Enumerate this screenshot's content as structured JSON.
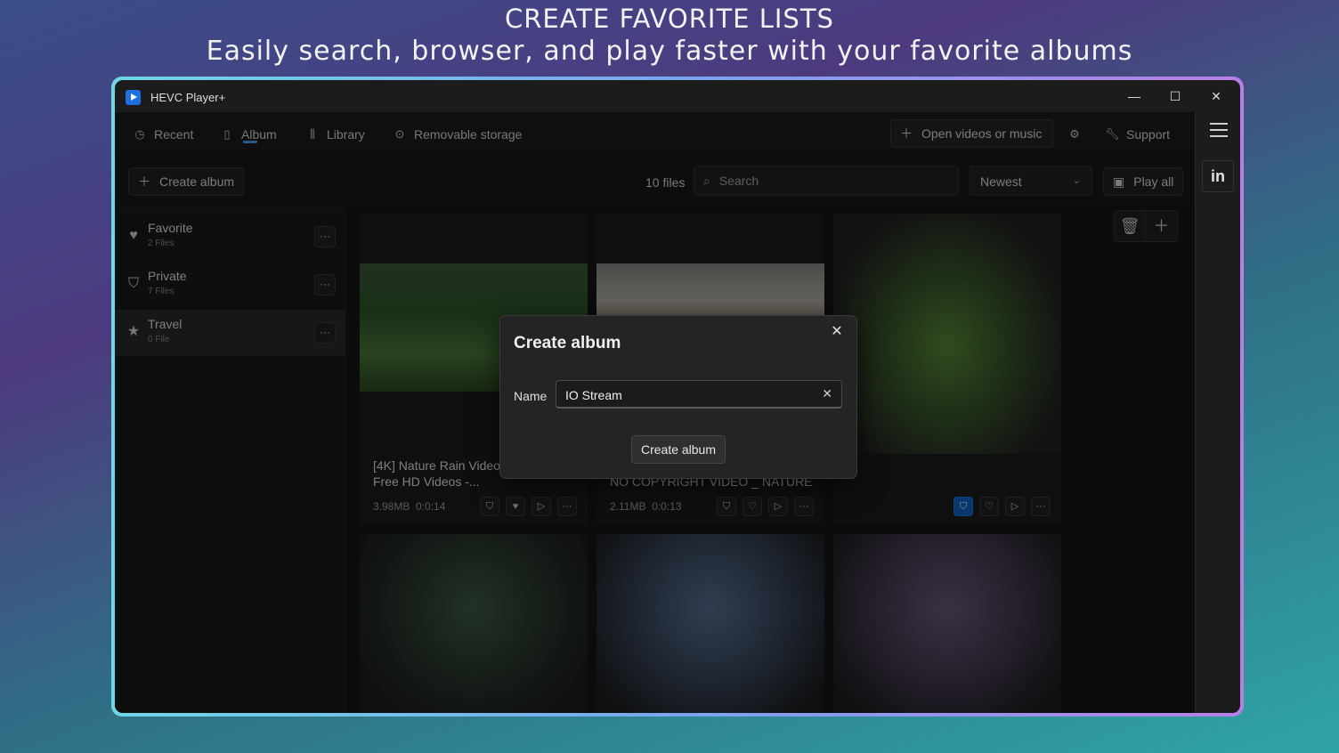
{
  "promo": {
    "title": "CREATE FAVORITE LISTS",
    "subtitle": "Easily search, browser, and play faster with your favorite albums"
  },
  "window": {
    "app_title": "HEVC Player+",
    "minimize": "—",
    "maximize": "☐",
    "close": "✕"
  },
  "nav": {
    "items": [
      {
        "label": "Recent",
        "icon": "clock-icon"
      },
      {
        "label": "Album",
        "icon": "album-icon"
      },
      {
        "label": "Library",
        "icon": "library-icon"
      },
      {
        "label": "Removable storage",
        "icon": "disc-icon"
      }
    ],
    "open_label": "Open videos or music",
    "support_label": "Support"
  },
  "toolbar": {
    "create_album_label": "Create album",
    "file_count": "10 files",
    "search_placeholder": "Search",
    "sort_value": "Newest",
    "play_all_label": "Play all"
  },
  "albums": [
    {
      "name": "Favorite",
      "count": "2 Files",
      "icon": "heart-icon"
    },
    {
      "name": "Private",
      "count": "7 Files",
      "icon": "shield-icon"
    },
    {
      "name": "Travel",
      "count": "0 File",
      "icon": "star-icon"
    }
  ],
  "cards": [
    {
      "title": "[4K] Nature Rain Video footage _ Free HD Videos -...",
      "size": "3.98MB",
      "duration": "0:0:14"
    },
    {
      "title": "NO COPYRIGHT VIDEO _ NATURE",
      "size": "2.11MB",
      "duration": "0:0:13"
    }
  ],
  "dialog": {
    "title": "Create album",
    "name_label": "Name",
    "name_value": "IO Stream",
    "create_label": "Create album"
  },
  "rail": {
    "badge": "in"
  },
  "colors": {
    "accent": "#4aa3ff",
    "selected_button": "#1366c9"
  }
}
